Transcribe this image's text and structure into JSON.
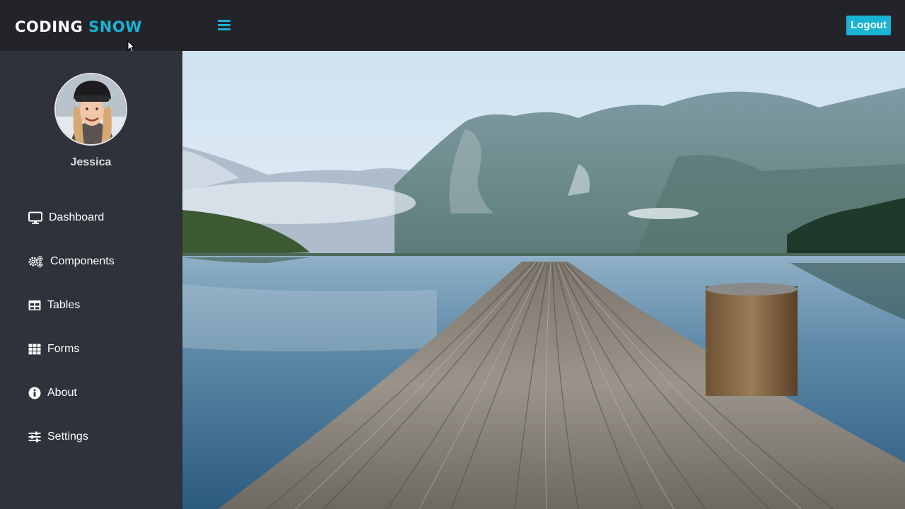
{
  "header": {
    "brand_part1": "CODING",
    "brand_part2": "SNOW",
    "menu_icon": "hamburger-menu-icon",
    "logout_label": "Logout"
  },
  "colors": {
    "accent": "#19b3d3",
    "topbar_bg": "#22242a",
    "sidebar_bg": "#2f323a"
  },
  "sidebar": {
    "user_name": "Jessica",
    "items": [
      {
        "label": "Dashboard",
        "icon": "monitor-icon"
      },
      {
        "label": "Components",
        "icon": "cogs-icon"
      },
      {
        "label": "Tables",
        "icon": "table-icon"
      },
      {
        "label": "Forms",
        "icon": "grid-icon"
      },
      {
        "label": "About",
        "icon": "info-circle-icon"
      },
      {
        "label": "Settings",
        "icon": "sliders-icon"
      }
    ]
  }
}
